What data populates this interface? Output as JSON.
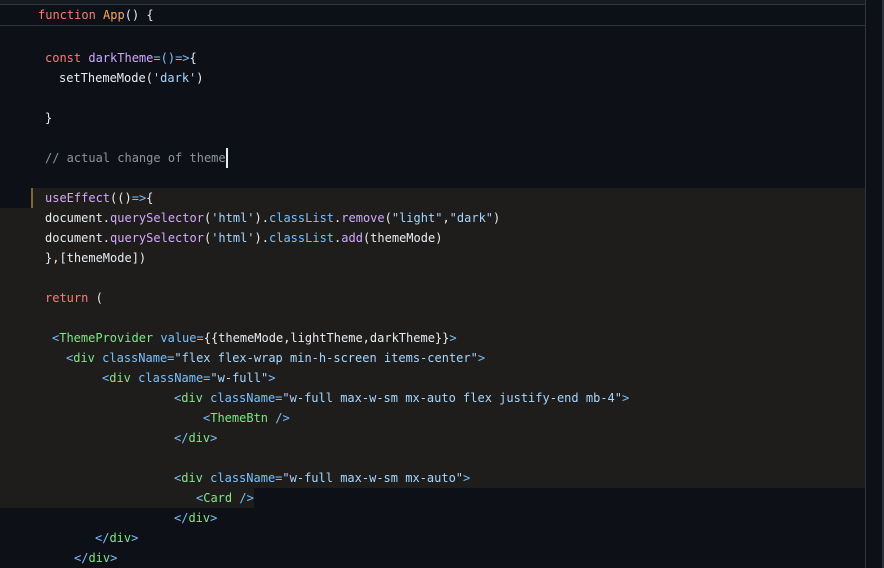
{
  "sticky_header": {
    "kw": "function",
    "name": "App",
    "rest": "() {"
  },
  "lines": {
    "l1": {
      "kw": "const",
      "name": "darkTheme",
      "arrow": "=()=>",
      "brace": "{"
    },
    "l2": {
      "text": "setThemeMode(",
      "str": "'dark'",
      "close": ")"
    },
    "l3": {
      "text": "}"
    },
    "l4": {
      "comment": "// actual change of theme"
    },
    "l5": {
      "fn": "useEffect",
      "paren": "(()",
      "arrow": "=>",
      "brace": "{"
    },
    "l6": {
      "obj": "document.",
      "method": "querySelector",
      "open": "(",
      "str1": "'html'",
      "close": ").",
      "prop": "classList",
      "dot": ".",
      "method2": "remove",
      "open2": "(",
      "str2": "\"light\"",
      "comma": ",",
      "str3": "\"dark\"",
      "close2": ")"
    },
    "l7": {
      "obj": "document.",
      "method": "querySelector",
      "open": "(",
      "str1": "'html'",
      "close": ").",
      "prop": "classList",
      "dot": ".",
      "method2": "add",
      "rest": "(themeMode)"
    },
    "l8": {
      "text": "},[themeMode])"
    },
    "l9": {
      "kw": "return",
      "rest": " ("
    },
    "l10": {
      "open": "<",
      "tag": "ThemeProvider",
      "attr": " value=",
      "val": "{{themeMode,lightTheme,darkTheme}}",
      "close": ">"
    },
    "l11": {
      "open": "<",
      "tag": "div",
      "attr": " className=",
      "val": "\"flex flex-wrap min-h-screen items-center\"",
      "close": ">"
    },
    "l12": {
      "open": "<",
      "tag": "div",
      "attr": " className=",
      "val": "\"w-full\"",
      "close": ">"
    },
    "l13": {
      "open": "<",
      "tag": "div",
      "attr": " className=",
      "val": "\"w-full max-w-sm mx-auto flex justify-end mb-4\"",
      "close": ">"
    },
    "l14": {
      "open": "<",
      "tag": "ThemeBtn",
      "close": " />"
    },
    "l15": {
      "open": "</",
      "tag": "div",
      "close": ">"
    },
    "l16": {
      "open": "<",
      "tag": "div",
      "attr": " className=",
      "val": "\"w-full max-w-sm mx-auto\"",
      "close": ">"
    },
    "l17": {
      "open": "<",
      "tag": "Card",
      "close": " />"
    },
    "l18": {
      "open": "</",
      "tag": "div",
      "close": ">"
    },
    "l19": {
      "open": "</",
      "tag": "div",
      "close": ">"
    },
    "l20": {
      "open": "</",
      "tag": "div",
      "close": ">"
    }
  }
}
